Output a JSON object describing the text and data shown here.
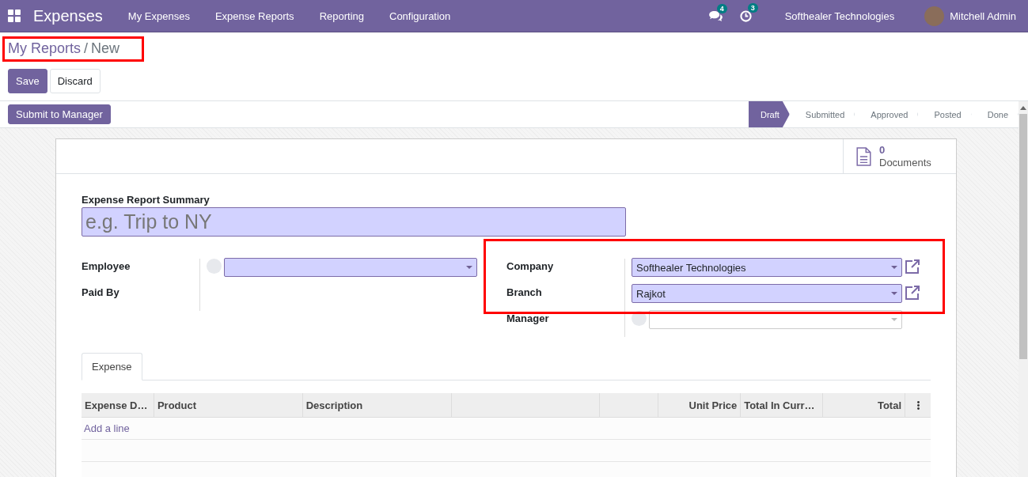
{
  "navbar": {
    "app_name": "Expenses",
    "menu": [
      "My Expenses",
      "Expense Reports",
      "Reporting",
      "Configuration"
    ],
    "messages_count": "4",
    "activities_count": "3",
    "company": "Softhealer Technologies",
    "user": "Mitchell Admin"
  },
  "breadcrumb": {
    "parent": "My Reports",
    "separator": "/",
    "current": "New"
  },
  "buttons": {
    "save": "Save",
    "discard": "Discard",
    "submit": "Submit to Manager"
  },
  "status_steps": [
    {
      "label": "Draft",
      "selected": true
    },
    {
      "label": "Submitted",
      "selected": false
    },
    {
      "label": "Approved",
      "selected": false
    },
    {
      "label": "Posted",
      "selected": false
    },
    {
      "label": "Done",
      "selected": false
    }
  ],
  "smart_button": {
    "count": "0",
    "label": "Documents"
  },
  "summary": {
    "label": "Expense Report Summary",
    "placeholder": "e.g. Trip to NY"
  },
  "left_fields": [
    {
      "label": "Employee",
      "kind": "select",
      "required": true,
      "avatar": true,
      "open_link": false
    },
    {
      "label": "Paid By",
      "kind": "none"
    }
  ],
  "right_fields": [
    {
      "label": "Company",
      "kind": "select",
      "value": "Softhealer Technologies",
      "required": true,
      "avatar": false,
      "open_link": true
    },
    {
      "label": "Branch",
      "kind": "select",
      "value": "Rajkot",
      "required": true,
      "avatar": false,
      "open_link": true
    },
    {
      "label": "Manager",
      "kind": "select",
      "required": false,
      "avatar": true,
      "open_link": false
    }
  ],
  "tabs": [
    {
      "label": "Expense",
      "selected": true
    }
  ],
  "table": {
    "columns": [
      {
        "kind": "text",
        "label": "Expense D…"
      },
      {
        "kind": "text",
        "label": "Product"
      },
      {
        "kind": "text",
        "label": "Description"
      },
      {
        "kind": "blank"
      },
      {
        "kind": "blank"
      },
      {
        "kind": "number",
        "label": "Unit Price"
      },
      {
        "kind": "text",
        "label": "Total In Curr…"
      },
      {
        "kind": "number",
        "label": "Total"
      }
    ],
    "add_line": "Add a line"
  }
}
